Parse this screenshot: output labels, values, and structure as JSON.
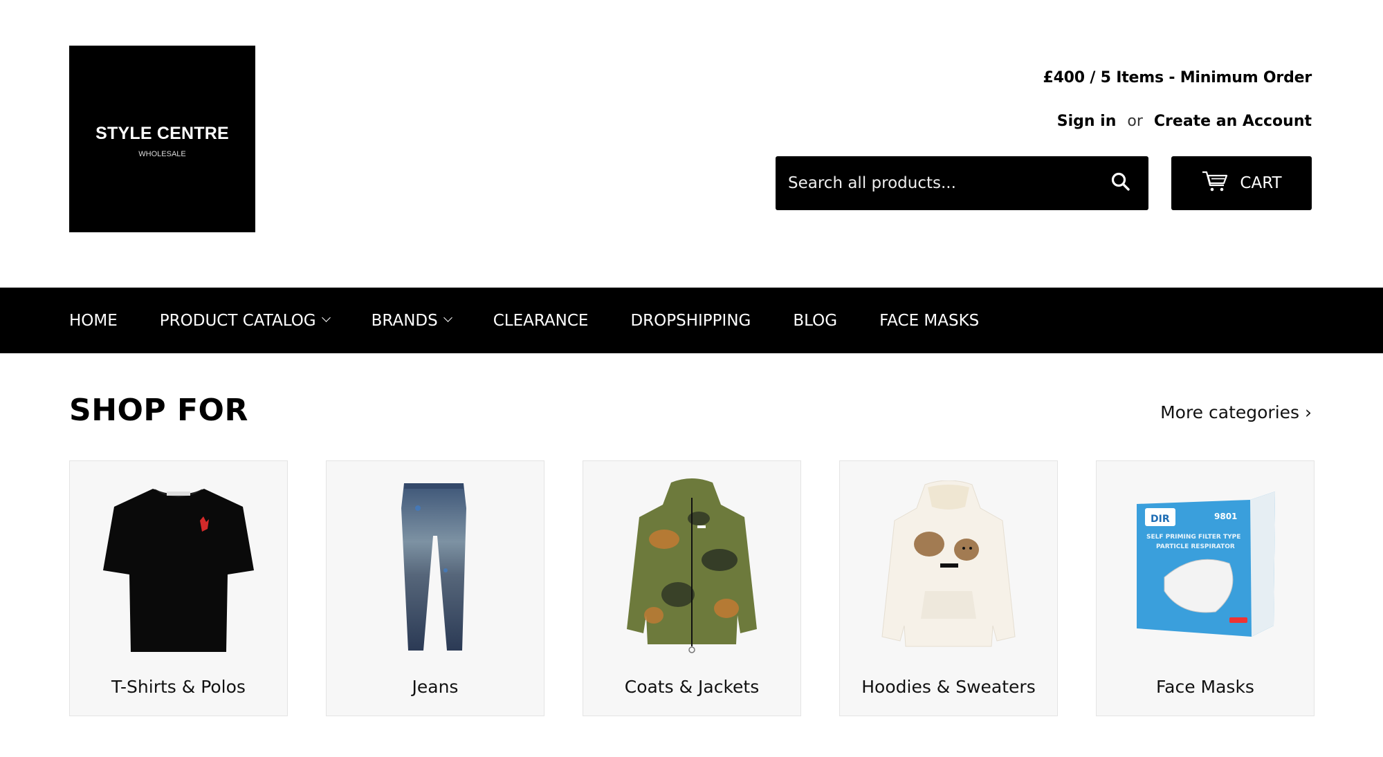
{
  "header": {
    "logo": {
      "title": "STYLE CENTRE",
      "subtitle": "WHOLESALE"
    },
    "min_order": "£400 / 5 Items - Minimum Order",
    "account": {
      "sign_in": "Sign in",
      "or": "or",
      "create_account": "Create an Account"
    },
    "search": {
      "placeholder": "Search all products...",
      "value": "",
      "icon": "search-icon"
    },
    "cart": {
      "label": "CART",
      "icon": "cart-icon"
    }
  },
  "nav": {
    "items": [
      {
        "label": "HOME",
        "has_dropdown": false
      },
      {
        "label": "PRODUCT CATALOG",
        "has_dropdown": true
      },
      {
        "label": "BRANDS",
        "has_dropdown": true
      },
      {
        "label": "CLEARANCE",
        "has_dropdown": false
      },
      {
        "label": "DROPSHIPPING",
        "has_dropdown": false
      },
      {
        "label": "BLOG",
        "has_dropdown": false
      },
      {
        "label": "FACE MASKS",
        "has_dropdown": false
      }
    ]
  },
  "shop_for": {
    "title": "SHOP FOR",
    "more_link": "More categories ›",
    "categories": [
      {
        "label": "T-Shirts & Polos",
        "image": "black-tshirt"
      },
      {
        "label": "Jeans",
        "image": "blue-biker-jeans"
      },
      {
        "label": "Coats & Jackets",
        "image": "camo-jacket"
      },
      {
        "label": "Hoodies & Sweaters",
        "image": "white-bear-hoodie"
      },
      {
        "label": "Face Masks",
        "image": "respirator-mask-box"
      }
    ]
  },
  "colors": {
    "primary": "#000000",
    "background": "#ffffff",
    "card_bg": "#f7f7f7"
  }
}
